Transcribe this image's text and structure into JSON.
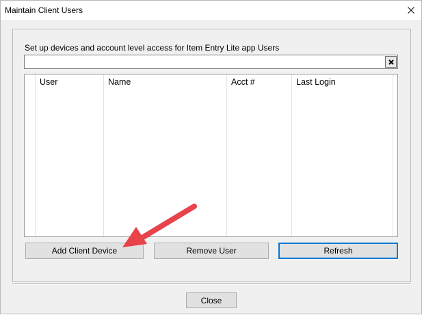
{
  "window": {
    "title": "Maintain Client Users"
  },
  "description": "Set up devices and account level access for Item Entry Lite app Users",
  "filter": {
    "value": "",
    "placeholder": ""
  },
  "grid": {
    "columns": [
      "User",
      "Name",
      "Acct #",
      "Last Login"
    ],
    "rows": []
  },
  "buttons": {
    "add_client_device": "Add Client Device",
    "remove_user": "Remove User",
    "refresh": "Refresh",
    "close": "Close"
  },
  "annotation": {
    "arrow_color": "#e8424a"
  },
  "icons": {
    "window_close": "close-x-icon",
    "filter_clear": "clear-x-icon"
  }
}
